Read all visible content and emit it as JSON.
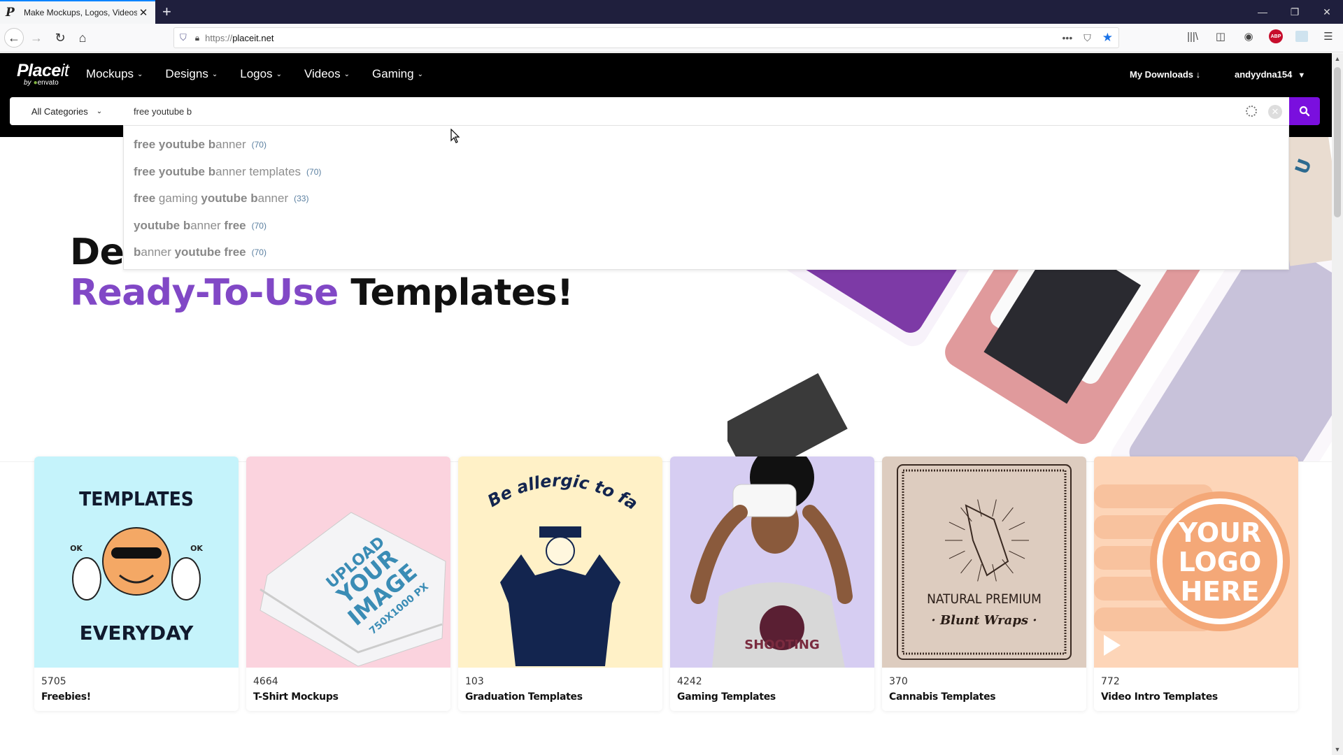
{
  "browser": {
    "tab_title": "Make Mockups, Logos, Videos",
    "tab_favicon": "P",
    "new_tab_icon": "+",
    "url_scheme": "https://",
    "url_host": "placeit.net",
    "window_controls": [
      "minimize",
      "restore",
      "close"
    ]
  },
  "site": {
    "logo_main": "Place",
    "logo_main_suffix": "it",
    "logo_sub_by": "by",
    "logo_sub_brand": "envato",
    "nav": [
      {
        "label": "Mockups"
      },
      {
        "label": "Designs"
      },
      {
        "label": "Logos"
      },
      {
        "label": "Videos"
      },
      {
        "label": "Gaming"
      }
    ],
    "downloads_label": "My Downloads",
    "downloads_icon": "↓",
    "username": "andyydna154"
  },
  "search": {
    "category": "All Categories",
    "query": "free youtube b",
    "suggestions": [
      {
        "parts": [
          {
            "t": "free youtube b",
            "b": true
          },
          {
            "t": "anner",
            "b": false
          }
        ],
        "count": "(70)"
      },
      {
        "parts": [
          {
            "t": "free youtube b",
            "b": true
          },
          {
            "t": "anner templates",
            "b": false
          }
        ],
        "count": "(70)"
      },
      {
        "parts": [
          {
            "t": "free ",
            "b": true
          },
          {
            "t": "gaming ",
            "b": false
          },
          {
            "t": "youtube b",
            "b": true
          },
          {
            "t": "anner",
            "b": false
          }
        ],
        "count": "(33)"
      },
      {
        "parts": [
          {
            "t": "youtube b",
            "b": true
          },
          {
            "t": "anner ",
            "b": false
          },
          {
            "t": "free",
            "b": true
          }
        ],
        "count": "(70)"
      },
      {
        "parts": [
          {
            "t": "b",
            "b": true
          },
          {
            "t": "anner ",
            "b": false
          },
          {
            "t": "youtube free",
            "b": true
          }
        ],
        "count": "(70)"
      }
    ]
  },
  "hero": {
    "line1_visible": "Des",
    "line2_purple": "Ready-To-Use",
    "line2_rest": " Templates!",
    "accent_color": "#8148c6"
  },
  "categories": [
    {
      "count": "5705",
      "title": "Freebies!",
      "bg": "#c5f3fb",
      "art": {
        "top": "TEMPLATES",
        "bottom": "EVERYDAY",
        "badge": "OK"
      }
    },
    {
      "count": "4664",
      "title": "T-Shirt Mockups",
      "bg": "#fbd3de",
      "art": {
        "l1": "UPLOAD",
        "l2": "YOUR",
        "l3": "IMAGE",
        "l4": "750X1000 PX"
      }
    },
    {
      "count": "103",
      "title": "Graduation Templates",
      "bg": "#fff1c7",
      "art": {
        "text": "Be allergic to fail"
      }
    },
    {
      "count": "4242",
      "title": "Gaming Templates",
      "bg": "#d6cdf2",
      "art": {
        "text": "SHOOTING"
      }
    },
    {
      "count": "370",
      "title": "Cannabis Templates",
      "bg": "#ddccbf",
      "art": {
        "l1": "NATURAL PREMIUM",
        "l2": "· Blunt Wraps ·"
      }
    },
    {
      "count": "772",
      "title": "Video Intro Templates",
      "bg": "#fdd5b8",
      "art": {
        "l1": "YOUR",
        "l2": "LOGO",
        "l3": "HERE"
      }
    }
  ],
  "colors": {
    "brand_purple": "#7a0fde",
    "header_bg": "#000000",
    "tabstrip_bg": "#1f1f3d"
  }
}
